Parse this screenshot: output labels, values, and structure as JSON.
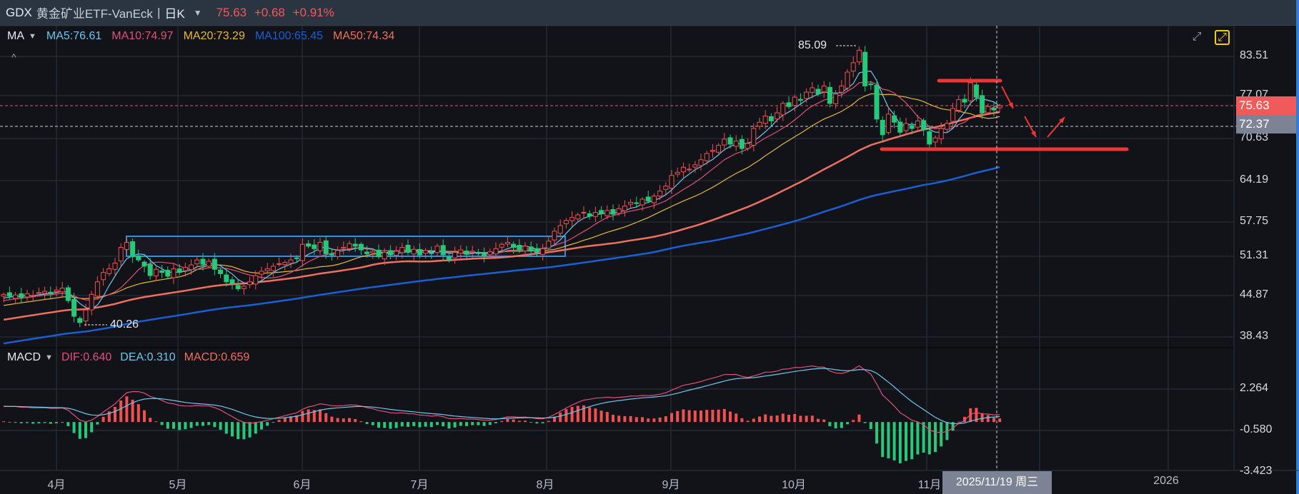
{
  "header": {
    "symbol": "GDX",
    "name": "黄金矿业ETF-VanEck",
    "separator": "|",
    "period": "日K",
    "dropdown_icon": "▼",
    "price": "75.63",
    "change": "+0.68",
    "change_pct": "+0.91%"
  },
  "ma_legend": {
    "title": "MA",
    "ma5": "MA5:76.61",
    "ma10": "MA10:74.97",
    "ma20": "MA20:73.29",
    "ma100": "MA100:65.45",
    "ma50": "MA50:74.34"
  },
  "macd_legend": {
    "title": "MACD",
    "dif": "DIF:0.640",
    "dea": "DEA:0.310",
    "macd": "MACD:0.659"
  },
  "colors": {
    "up": "#f05050",
    "down": "#26c97a",
    "ma5": "#6ec6f0",
    "ma10": "#e0507a",
    "ma20": "#e6b83a",
    "ma50": "#f07060",
    "ma100": "#1a5fd6",
    "box": "#2f8fe0",
    "annotation": "#f03535"
  },
  "icons": {
    "collapse": "^",
    "expand": "expand-arrows-icon",
    "fullscreen": "fullscreen-icon"
  },
  "price_axis": [
    "83.51",
    "77.07",
    "70.63",
    "64.19",
    "57.75",
    "51.31",
    "44.87",
    "38.43"
  ],
  "macd_axis": [
    "2.264",
    "-0.580",
    "-3.423"
  ],
  "last_price_label": "75.63",
  "crosshair_price_label": "72.37",
  "crosshair_date_label": "2025/11/19 周三",
  "high_label": "85.09",
  "low_label": "40.26",
  "months": [
    "4月",
    "5月",
    "6月",
    "7月",
    "8月",
    "9月",
    "10月",
    "11月",
    "2026"
  ],
  "chart_data": {
    "type": "candlestick",
    "title": "GDX 黄金矿业ETF-VanEck 日K",
    "first_date": "2025-03-19",
    "last_date": "2025-11-19",
    "closes": [
      45.5,
      45.2,
      45.4,
      45.0,
      45.6,
      45.3,
      45.8,
      46.0,
      45.6,
      46.2,
      46.5,
      44.5,
      42.0,
      41.0,
      43.0,
      45.5,
      47.5,
      49.0,
      49.6,
      50.5,
      53.0,
      53.8,
      51.5,
      51.0,
      50.0,
      48.5,
      49.5,
      49.0,
      48.4,
      49.6,
      49.0,
      49.8,
      50.2,
      51.0,
      50.3,
      50.8,
      49.5,
      48.8,
      47.5,
      47.2,
      46.4,
      46.8,
      47.5,
      48.5,
      49.2,
      49.6,
      50.0,
      50.4,
      50.6,
      51.0,
      51.2,
      53.5,
      53.2,
      52.8,
      53.8,
      52.0,
      51.8,
      52.5,
      53.0,
      53.6,
      53.2,
      52.6,
      52.0,
      52.4,
      51.5,
      52.2,
      51.8,
      52.4,
      53.0,
      52.2,
      52.7,
      51.8,
      52.5,
      52.0,
      53.2,
      51.8,
      51.0,
      52.2,
      52.6,
      51.9,
      52.4,
      52.0,
      51.6,
      52.3,
      52.8,
      53.5,
      53.8,
      53.0,
      52.6,
      53.2,
      52.5,
      52.2,
      52.8,
      54.0,
      55.6,
      56.5,
      57.3,
      57.8,
      58.2,
      58.6,
      58.0,
      58.6,
      58.4,
      58.9,
      58.3,
      59.2,
      59.6,
      60.2,
      60.0,
      60.7,
      60.4,
      61.2,
      62.0,
      62.8,
      64.5,
      65.0,
      65.8,
      65.5,
      66.2,
      67.0,
      68.0,
      68.5,
      69.3,
      70.3,
      69.5,
      70.0,
      68.8,
      69.6,
      72.0,
      73.0,
      74.0,
      73.2,
      74.5,
      76.0,
      75.5,
      77.0,
      76.5,
      77.8,
      78.5,
      77.5,
      78.8,
      76.0,
      77.5,
      78.8,
      81.0,
      82.5,
      84.5,
      78.8,
      79.0,
      73.5,
      71.0,
      74.3,
      73.0,
      71.4,
      72.8,
      72.0,
      73.2,
      71.8,
      69.5,
      70.5,
      72.0,
      72.8,
      75.2,
      76.6,
      76.2,
      79.3,
      77.0,
      74.5,
      75.5,
      74.95,
      75.63
    ],
    "period_high": 85.09,
    "period_low": 40.26,
    "indicators": [
      "MA5",
      "MA10",
      "MA20",
      "MA50",
      "MA100",
      "MACD(12,26,9)"
    ],
    "price_range": [
      38.43,
      83.51
    ],
    "macd_range": [
      -3.423,
      2.264
    ],
    "annotations": [
      "consolidation box Apr-Aug ~51-54",
      "resistance line ~79",
      "support line ~69",
      "three trend arrows"
    ]
  }
}
